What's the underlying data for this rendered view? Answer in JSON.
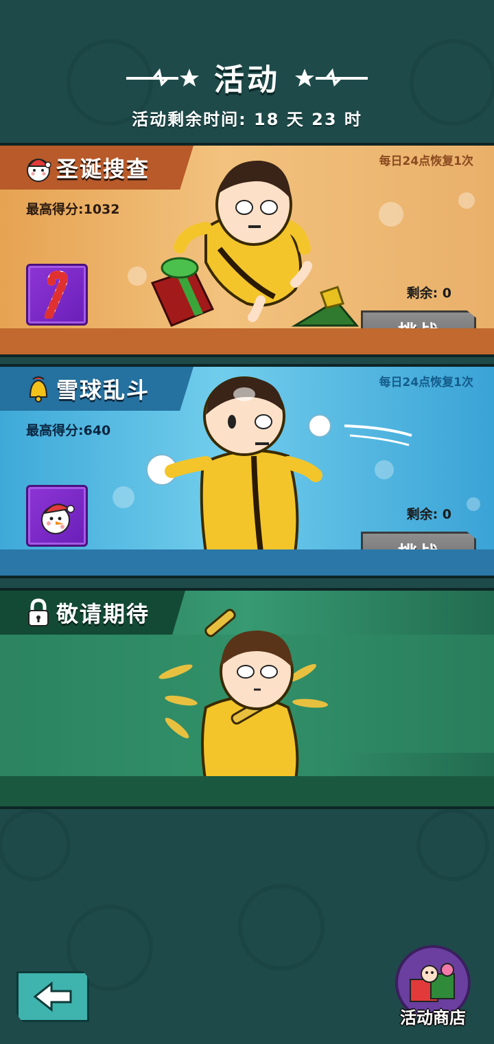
{
  "header": {
    "title": "活动",
    "timer_text": "活动剩余时间: 18 天 23 时"
  },
  "events": [
    {
      "title": "圣诞搜查",
      "refresh_note": "每日24点恢复1次",
      "best_score": "最高得分:1032",
      "remaining": "剩余: 0",
      "button_label": "挑战",
      "item_icon": "candy-cane-icon"
    },
    {
      "title": "雪球乱斗",
      "refresh_note": "每日24点恢复1次",
      "best_score": "最高得分:640",
      "remaining": "剩余: 0",
      "button_label": "挑战",
      "item_icon": "snowman-icon"
    },
    {
      "title": "敬请期待",
      "locked": true
    }
  ],
  "footer": {
    "back_icon": "arrow-left-icon",
    "shop_label": "活动商店"
  },
  "colors": {
    "background": "#1f4a4a",
    "card_christmas": "#e6a352",
    "card_snowball": "#3ea9d8",
    "card_locked": "#287a5a",
    "button_gray": "#7a7a7a"
  }
}
